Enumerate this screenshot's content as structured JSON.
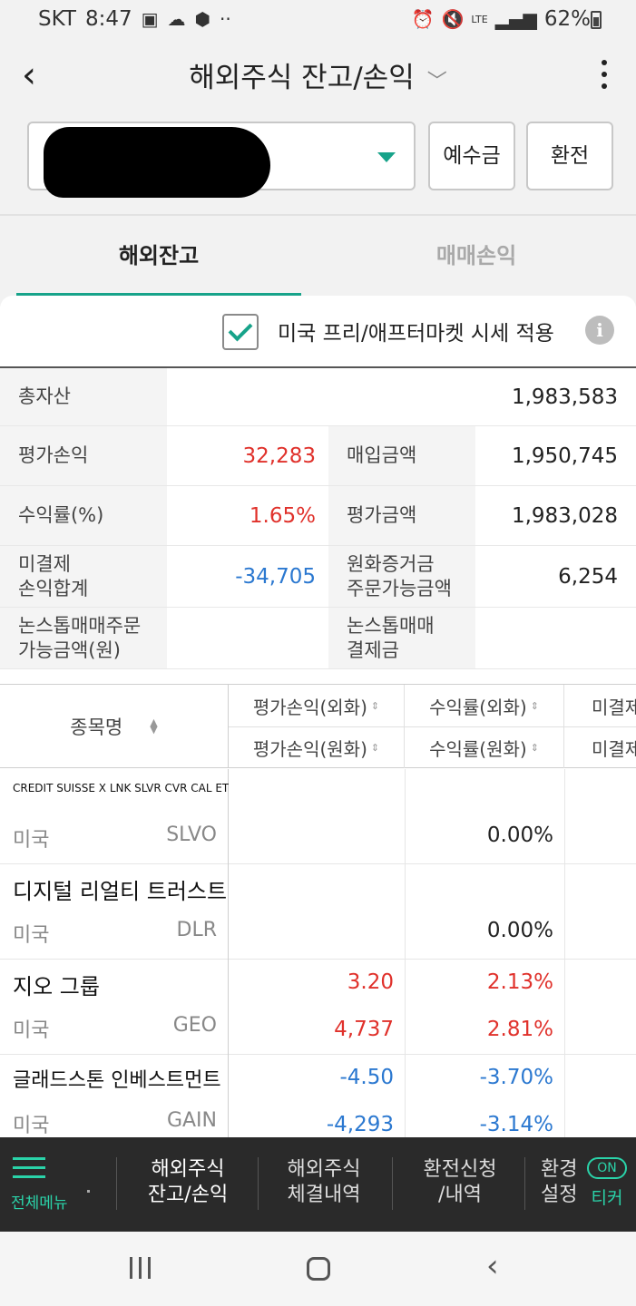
{
  "status": {
    "carrier": "SKT",
    "time": "8:47",
    "battery": "62%",
    "network": "LTE"
  },
  "header": {
    "title": "해외주식 잔고/손익"
  },
  "account": {
    "deposit_label": "예수금",
    "fx_label": "환전"
  },
  "tabs": [
    {
      "label": "해외잔고"
    },
    {
      "label": "매매손익"
    }
  ],
  "premarket": {
    "label": "미국 프리/애프터마켓 시세 적용"
  },
  "summary": {
    "total_assets_label": "총자산",
    "total_assets": "1,983,583",
    "eval_pl_label": "평가손익",
    "eval_pl": "32,283",
    "purchase_label": "매입금액",
    "purchase": "1,950,745",
    "return_label": "수익률(%)",
    "return": "1.65%",
    "eval_amount_label": "평가금액",
    "eval_amount": "1,983,028",
    "unsettled_label_1": "미결제",
    "unsettled_label_2": "손익합계",
    "unsettled": "-34,705",
    "krw_margin_label_1": "원화증거금",
    "krw_margin_label_2": "주문가능금액",
    "krw_margin": "6,254",
    "nonstop_order_label_1": "논스톱매매주문",
    "nonstop_order_label_2": "가능금액(원)",
    "nonstop_settle_label_1": "논스톱매매",
    "nonstop_settle_label_2": "결제금"
  },
  "grid_header": {
    "name": "종목명",
    "col1_top": "평가손익(외화)",
    "col1_bottom": "평가손익(원화)",
    "col2_top": "수익률(외화)",
    "col2_bottom": "수익률(원화)",
    "col3_top": "미결제",
    "col3_bottom": "미결제"
  },
  "holdings": [
    {
      "name": "CREDIT SUISSE X LNK SLVR CVR CAL ETN",
      "market": "미국",
      "ticker": "SLVO",
      "pl_fx": "",
      "pl_krw": "",
      "ret_fx": "",
      "ret_krw": "0.00%"
    },
    {
      "name": "디지털 리얼티 트러스트",
      "market": "미국",
      "ticker": "DLR",
      "pl_fx": "",
      "pl_krw": "",
      "ret_fx": "",
      "ret_krw": "0.00%"
    },
    {
      "name": "지오 그룹",
      "market": "미국",
      "ticker": "GEO",
      "pl_fx": "3.20",
      "pl_krw": "4,737",
      "ret_fx": "2.13%",
      "ret_krw": "2.81%"
    },
    {
      "name": "글래드스톤 인베스트먼트",
      "market": "미국",
      "ticker": "GAIN",
      "pl_fx": "-4.50",
      "pl_krw": "-4,293",
      "ret_fx": "-3.70%",
      "ret_krw": "-3.14%"
    }
  ],
  "bottom_nav": {
    "menu": "전체메뉴",
    "items": [
      {
        "line1": "해외주식",
        "line2": "잔고/손익"
      },
      {
        "line1": "해외주식",
        "line2": "체결내역"
      },
      {
        "line1": "환전신청",
        "line2": "/내역"
      },
      {
        "line1": "환경",
        "line2": "설정"
      }
    ],
    "ticker_on": "ON",
    "ticker": "티커"
  },
  "colors": {
    "accent": "#17a38a",
    "positive": "#e0312b",
    "negative": "#2b78d0"
  }
}
